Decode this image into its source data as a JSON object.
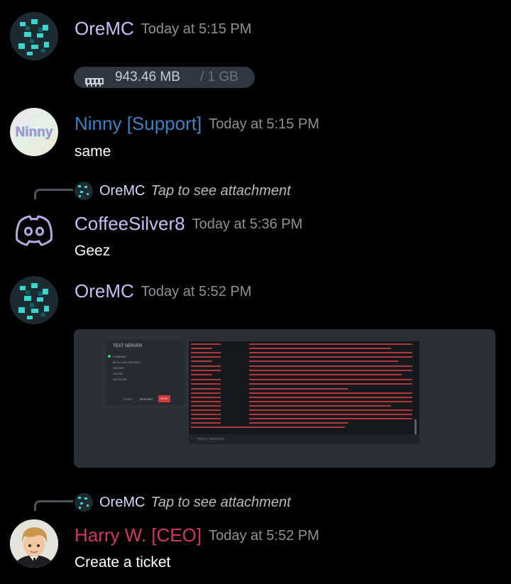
{
  "messages": [
    {
      "username": "OreMC",
      "timestamp": "Today at 5:15 PM",
      "color": "#c9bdf5"
    },
    {
      "username": "Ninny [Support]",
      "timestamp": "Today at 5:15 PM",
      "text": "same",
      "color": "#3b82c4"
    },
    {
      "username": "CoffeeSilver8",
      "timestamp": "Today at 5:36 PM",
      "text": "Geez",
      "color": "#c9bdf5"
    },
    {
      "username": "OreMC",
      "timestamp": "Today at 5:52 PM",
      "color": "#c9bdf5"
    },
    {
      "username": "Harry W. [CEO]",
      "timestamp": "Today at 5:52 PM",
      "text": "Create a ticket",
      "color": "#d4336a"
    }
  ],
  "ram_pill": {
    "used": "943.46 MB",
    "total": "/ 1 GB"
  },
  "replies": [
    {
      "name": "OreMC",
      "action": "Tap to see attachment"
    },
    {
      "name": "OreMC",
      "action": "Tap to see attachment"
    }
  ],
  "attachment": {
    "server_name": "TEST SERVER",
    "status": "RUNNING",
    "ip": "85.111.299.155:25621",
    "cpu": "165.84%",
    "disk": "120 GB",
    "ram": "944.03 MB",
    "buttons": [
      "START",
      "RESTART",
      "STOP"
    ],
    "console_warn": "[13:50:54 WARN]: OreMC moved too quickly! -9.768046850837193,-2.0120059486616574,-7.3733261457165259",
    "console_footer": "[13:50:31 ERROR]: --- DO NOT REPORT THIS TO PAPER - THIS IS NOT A BUG OR A CRASH ---",
    "command_placeholder": "Type a command..."
  },
  "colors": {
    "background": "#000000",
    "timestamp": "#8e9297",
    "reply_line": "#4f545c"
  }
}
